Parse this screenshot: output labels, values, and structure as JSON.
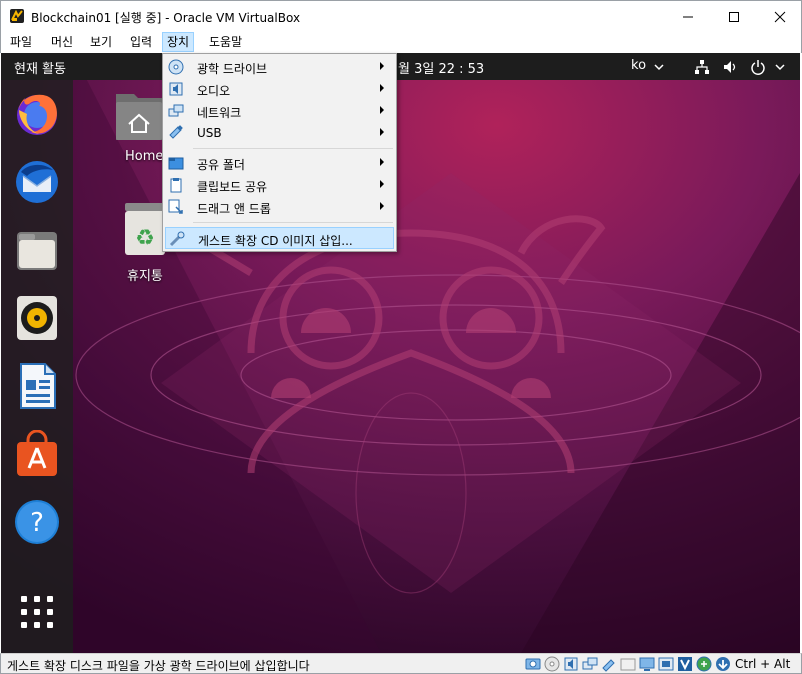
{
  "window": {
    "title": "Blockchain01 [실행 중] - Oracle VM VirtualBox",
    "minimize_glyph": "—",
    "maximize_glyph": "☐",
    "close_glyph": "✕"
  },
  "menubar": {
    "items": [
      {
        "label": "파일"
      },
      {
        "label": "머신"
      },
      {
        "label": "보기"
      },
      {
        "label": "입력"
      },
      {
        "label": "장치",
        "active": true
      },
      {
        "label": "도움말"
      }
    ]
  },
  "device_menu": {
    "items": [
      {
        "label": "광학 드라이브",
        "icon": "optical-drive-icon",
        "submenu": true
      },
      {
        "label": "오디오",
        "icon": "audio-icon",
        "submenu": true
      },
      {
        "label": "네트워크",
        "icon": "network-icon",
        "submenu": true
      },
      {
        "label": "USB",
        "icon": "usb-icon",
        "submenu": true
      },
      {
        "label": "공유 폴더",
        "icon": "shared-folder-icon",
        "submenu": true
      },
      {
        "label": "클립보드 공유",
        "icon": "clipboard-icon",
        "submenu": true
      },
      {
        "label": "드래그 앤 드롭",
        "icon": "drag-drop-icon",
        "submenu": true
      },
      {
        "label": "게스트 확장 CD 이미지 삽입...",
        "icon": "guest-additions-icon",
        "submenu": false,
        "highlighted": true
      }
    ]
  },
  "guest": {
    "topbar": {
      "activities": "현재 활동",
      "clock": "월 3일 22 : 53",
      "keyboard_layout": "ko"
    },
    "dock_apps": [
      "firefox-icon",
      "thunderbird-icon",
      "files-icon",
      "rhythmbox-icon",
      "libreoffice-writer-icon",
      "software-center-icon",
      "help-icon",
      "show-apps-icon"
    ],
    "desktop_icons": [
      {
        "label": "Home",
        "icon": "home-folder-icon"
      },
      {
        "label": "휴지통",
        "icon": "trash-icon"
      }
    ]
  },
  "statusbar": {
    "message": "게스트 확장 디스크 파일을 가상 광학 드라이브에 삽입합니다",
    "host_key": "Ctrl + Alt"
  },
  "colors": {
    "accent_highlight": "#cce8ff",
    "ubuntu_bg_dark": "#2c001e",
    "ubuntu_bg_mid": "#77216f",
    "ubuntu_orange": "#e95420"
  }
}
